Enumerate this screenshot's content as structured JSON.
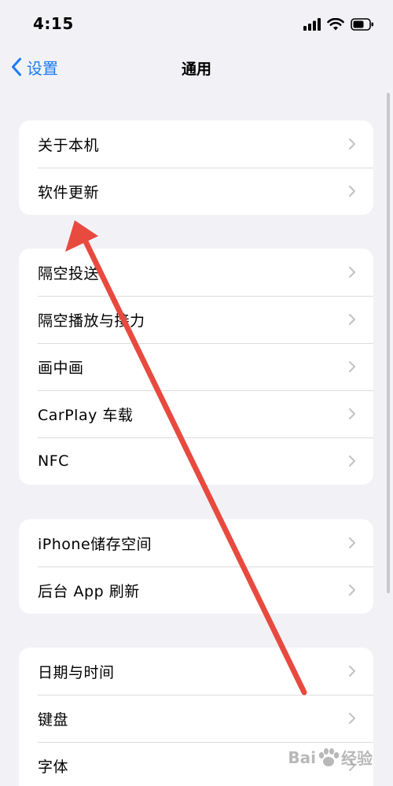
{
  "status_bar": {
    "time": "4:15"
  },
  "nav": {
    "back_label": "设置",
    "title": "通用"
  },
  "groups": [
    {
      "items": [
        {
          "label": "关于本机"
        },
        {
          "label": "软件更新"
        }
      ]
    },
    {
      "items": [
        {
          "label": "隔空投送"
        },
        {
          "label": "隔空播放与接力"
        },
        {
          "label": "画中画"
        },
        {
          "label": "CarPlay 车载"
        },
        {
          "label": "NFC"
        }
      ]
    },
    {
      "items": [
        {
          "label": "iPhone储存空间"
        },
        {
          "label": "后台 App 刷新"
        }
      ]
    },
    {
      "items": [
        {
          "label": "日期与时间"
        },
        {
          "label": "键盘"
        },
        {
          "label": "字体"
        }
      ]
    }
  ],
  "watermark": {
    "left": "Bai",
    "right": "经验"
  },
  "colors": {
    "accent": "#1a7cf6",
    "annotation": "#e84a3f",
    "background": "#f2f2f6"
  },
  "icons": [
    "signal-icon",
    "wifi-icon",
    "battery-icon",
    "chevron-left-icon",
    "chevron-right-icon"
  ]
}
